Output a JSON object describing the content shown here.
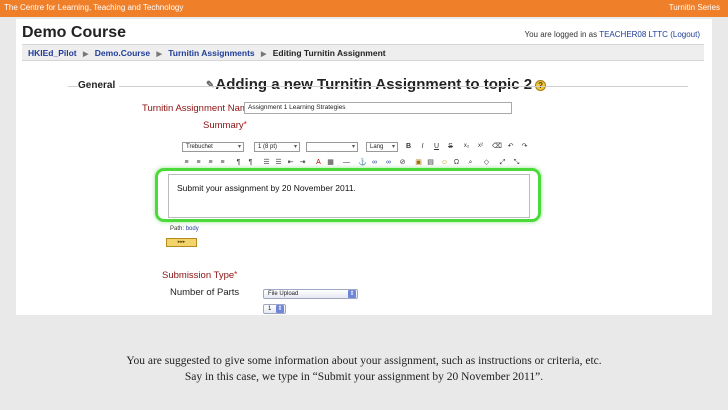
{
  "banner": {
    "left_text": "The Centre for Learning, Teaching and Technology",
    "right_text": "Turnitin Series"
  },
  "course": {
    "title": "Demo Course"
  },
  "login": {
    "prefix": "You are logged in as",
    "user": "TEACHER08 LTTC",
    "logout": "(Logout)"
  },
  "breadcrumb": [
    {
      "label": "HKIEd_Pilot"
    },
    {
      "label": "Demo.Course"
    },
    {
      "label": "Turnitin Assignments"
    },
    {
      "label": "Editing Turnitin Assignment"
    }
  ],
  "heading": {
    "text": "Adding a new Turnitin Assignment to topic 2",
    "help": "?"
  },
  "form": {
    "section": "General",
    "name_label": "Turnitin Assignment Name",
    "name_value": "Assignment 1 Learning Strategies",
    "summary_label": "Summary",
    "required_mark": "*",
    "editor": {
      "font": "Trebuchet",
      "size": "1 (8 pt)",
      "format": "",
      "lang": "Lang",
      "content": "Submit your assignment by 20 November 2011.",
      "path_label": "Path:",
      "path_value": "body"
    },
    "submission_type_label": "Submission Type",
    "submission_type_value": "File Upload",
    "parts_label": "Number of Parts",
    "parts_value": "1"
  },
  "caption": {
    "line1": "You are suggested to give some information about your assignment, such as instructions or criteria, etc.",
    "line2": "Say in this case, we type in “Submit your assignment by 20 November 2011”."
  },
  "colors": {
    "banner": "#f07f2a",
    "highlight": "#4cd93a",
    "link": "#1f3c99",
    "label": "#8a1010"
  }
}
